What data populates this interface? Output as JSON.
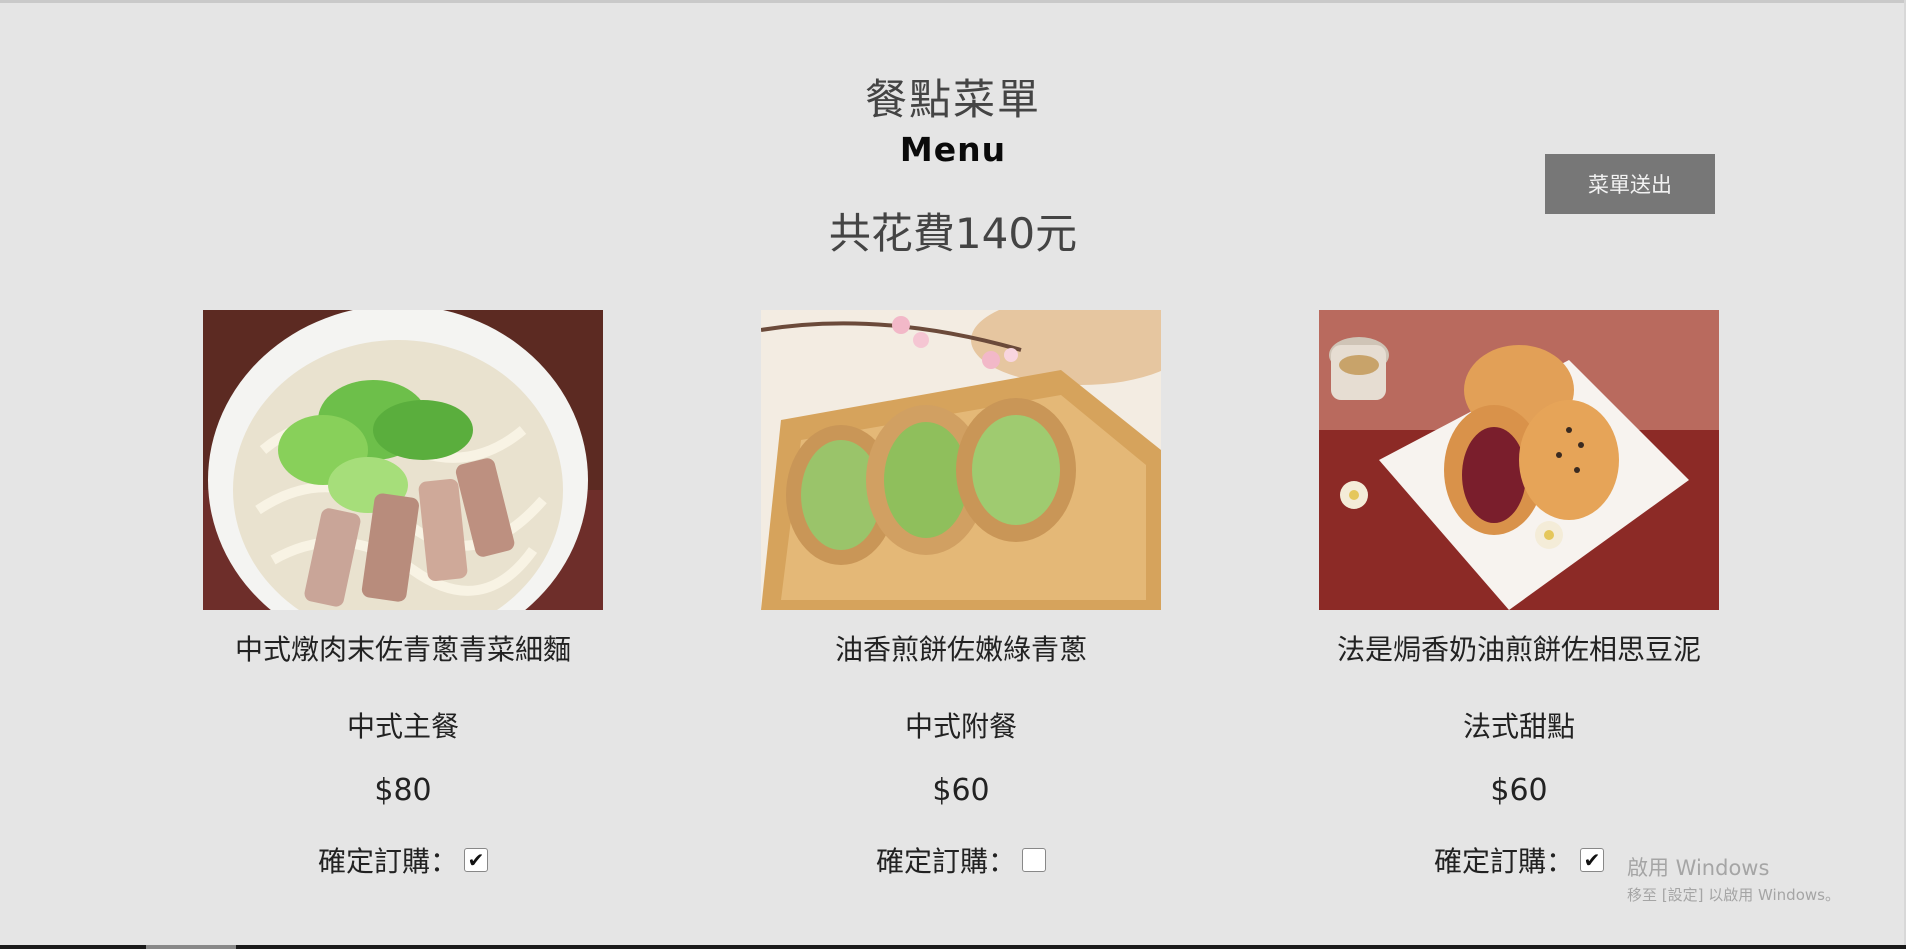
{
  "header": {
    "title_zh": "餐點菜單",
    "title_en": "Menu",
    "total_text": "共花費140元"
  },
  "submit_button_label": "菜單送出",
  "order_label": "確定訂購：",
  "menu_items": [
    {
      "name": "中式燉肉末佐青蔥青菜細麵",
      "category": "中式主餐",
      "price": "$80",
      "ordered": true,
      "image": "noodle-bowl-photo"
    },
    {
      "name": "油香煎餅佐嫩綠青蔥",
      "category": "中式附餐",
      "price": "$60",
      "ordered": false,
      "image": "scallion-pancake-photo"
    },
    {
      "name": "法是焗香奶油煎餅佐相思豆泥",
      "category": "法式甜點",
      "price": "$60",
      "ordered": true,
      "image": "red-bean-pancake-photo"
    }
  ],
  "watermark": {
    "title": "啟用 Windows",
    "subtitle": "移至 [設定] 以啟用 Windows。"
  }
}
